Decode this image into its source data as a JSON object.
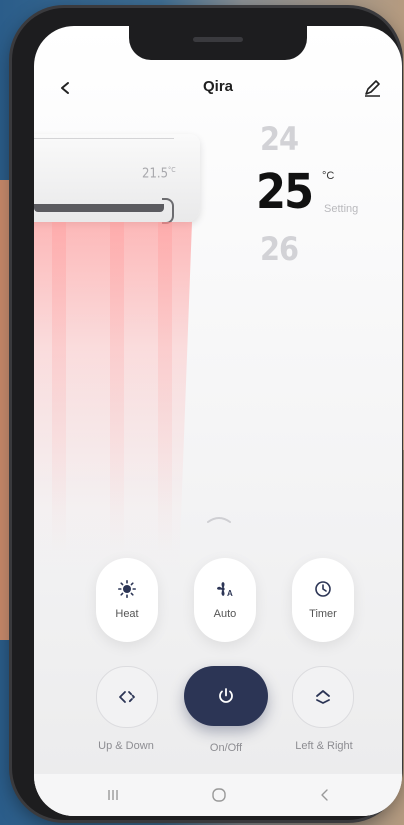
{
  "header": {
    "title": "Qira",
    "back_icon": "chevron-left-icon",
    "edit_icon": "pencil-icon"
  },
  "ac_unit": {
    "room_temp": "21.5",
    "room_temp_unit": "°C"
  },
  "temperature": {
    "up_value": "24",
    "current_value": "25",
    "unit": "°C",
    "setting_label": "Setting",
    "down_value": "26"
  },
  "modes": [
    {
      "label": "Heat",
      "icon": "sun-icon"
    },
    {
      "label": "Auto",
      "icon": "fan-auto-icon"
    },
    {
      "label": "Timer",
      "icon": "clock-icon"
    }
  ],
  "controls": {
    "swing_vertical_label": "Up & Down",
    "power_label": "On/Off",
    "swing_horizontal_label": "Left & Right"
  },
  "colors": {
    "accent": "#2c3555",
    "airflow": "#ff9a9a"
  },
  "navbar": {
    "items": [
      "recent-apps-icon",
      "home-icon",
      "back-icon"
    ]
  }
}
